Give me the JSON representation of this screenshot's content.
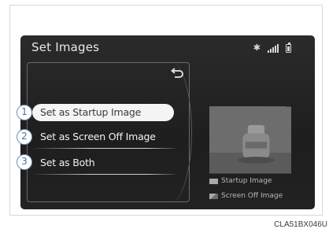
{
  "screen": {
    "title": "Set Images",
    "status_icons": [
      "bluetooth-icon",
      "signal-icon",
      "battery-icon"
    ],
    "back_icon": "return-arrow-icon"
  },
  "menu": {
    "items": [
      {
        "number": "1",
        "label": "Set as Startup Image",
        "selected": true
      },
      {
        "number": "2",
        "label": "Set as Screen Off Image",
        "selected": false
      },
      {
        "number": "3",
        "label": "Set as Both",
        "selected": false
      }
    ]
  },
  "legend": {
    "startup": "Startup Image",
    "screen_off": "Screen Off Image"
  },
  "caption": "CLA51BX046U",
  "colors": {
    "screen_bg": "#262626",
    "callout_border": "#6e8fb4",
    "selected_item_bg": "#f4f4f4"
  }
}
